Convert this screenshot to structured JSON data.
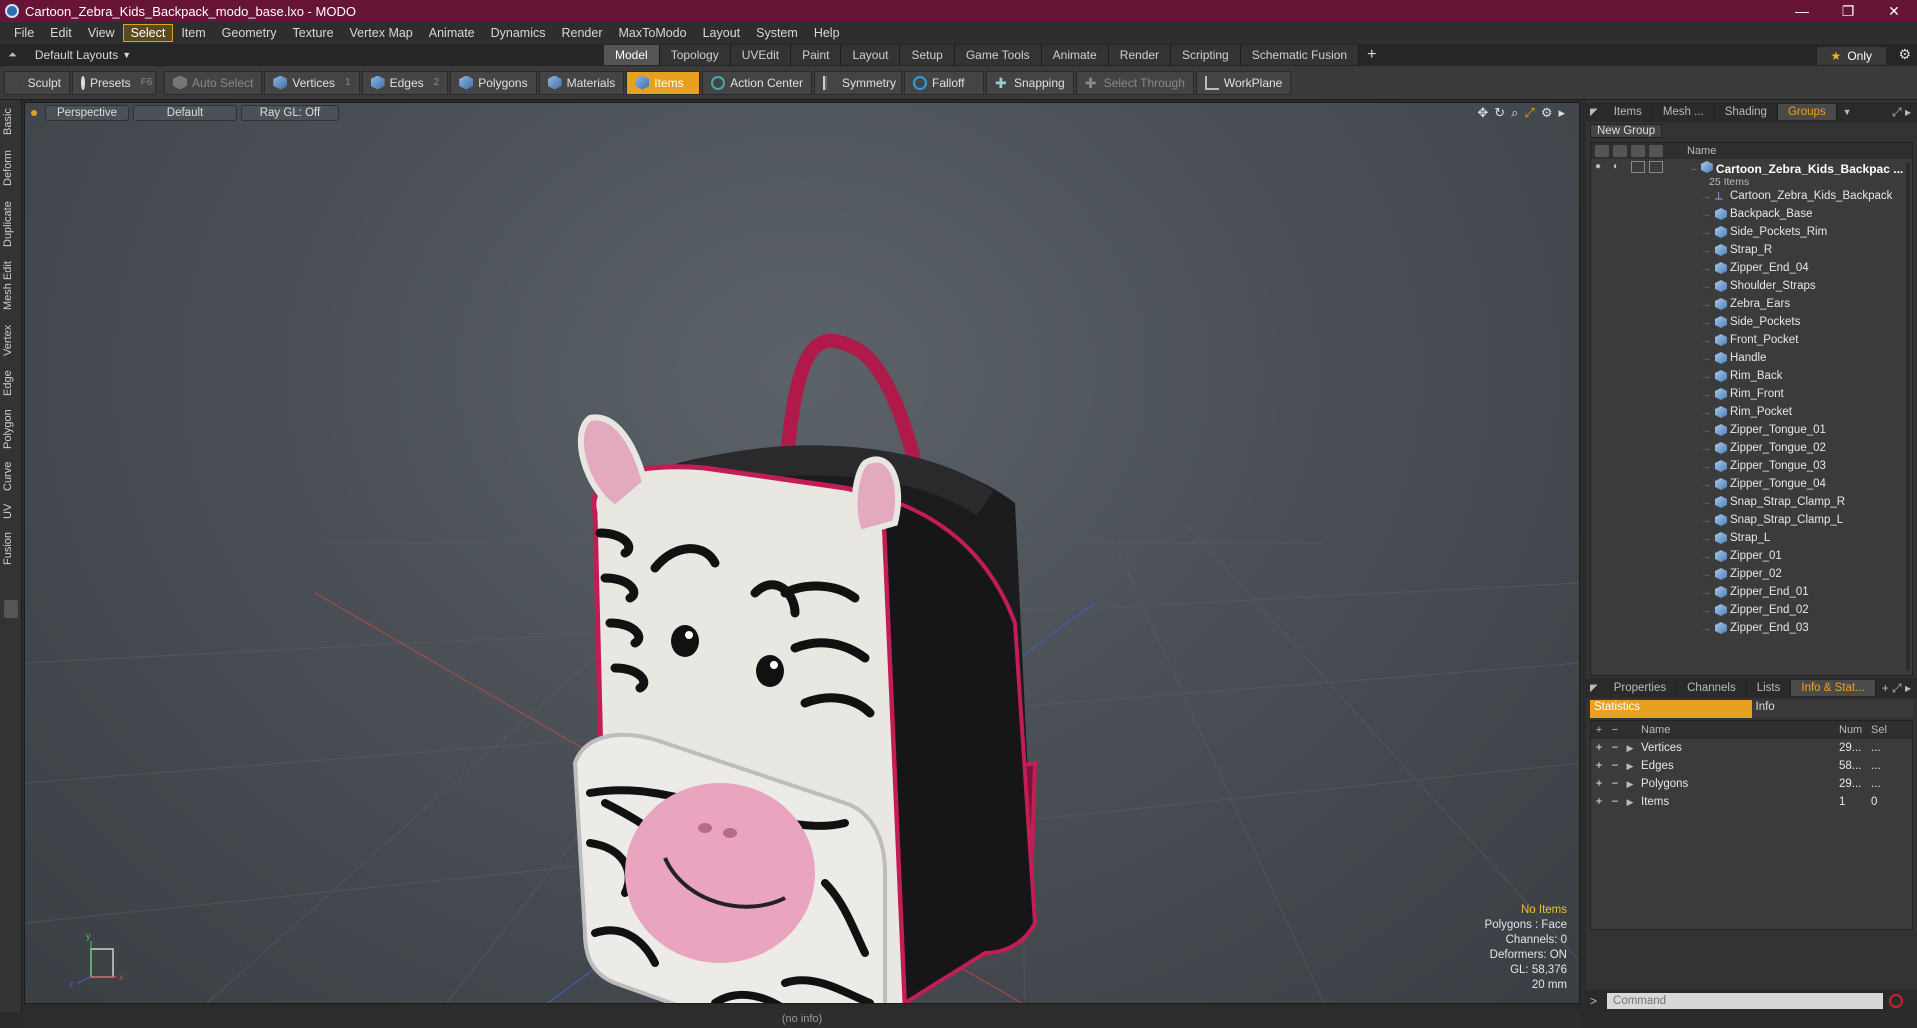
{
  "window": {
    "title": "Cartoon_Zebra_Kids_Backpack_modo_base.lxo - MODO",
    "controls": [
      "—",
      "❐",
      "✕"
    ]
  },
  "menu": [
    "File",
    "Edit",
    "View",
    "Select",
    "Item",
    "Geometry",
    "Texture",
    "Vertex Map",
    "Animate",
    "Dynamics",
    "Render",
    "MaxToModo",
    "Layout",
    "System",
    "Help"
  ],
  "menu_active": "Select",
  "layout_bar": {
    "layouts_label": "Default Layouts",
    "tabs": [
      "Model",
      "Topology",
      "UVEdit",
      "Paint",
      "Layout",
      "Setup",
      "Game Tools",
      "Animate",
      "Render",
      "Scripting",
      "Schematic Fusion"
    ],
    "active_tab": "Model",
    "only_label": "Only"
  },
  "toolbar": {
    "sculpt": "Sculpt",
    "presets": "Presets",
    "presets_hotkey": "F6",
    "auto_select": "Auto Select",
    "vertices": "Vertices",
    "vertices_hotkey": "1",
    "edges": "Edges",
    "edges_hotkey": "2",
    "polygons": "Polygons",
    "materials": "Materials",
    "items": "Items",
    "action_center": "Action Center",
    "symmetry": "Symmetry",
    "falloff": "Falloff",
    "snapping": "Snapping",
    "select_through": "Select Through",
    "workplane": "WorkPlane"
  },
  "left_tabs": [
    "Basic",
    "Deform",
    "Duplicate",
    "Mesh Edit",
    "Vertex",
    "Edge",
    "Polygon",
    "Curve",
    "UV",
    "Fusion"
  ],
  "viewport": {
    "view": "Perspective",
    "shading": "Default",
    "raygl": "Ray GL: Off",
    "info": {
      "selection": "No Items",
      "polygons": "Polygons : Face",
      "channels": "Channels: 0",
      "deformers": "Deformers: ON",
      "gl": "GL: 58,376",
      "scale": "20 mm"
    }
  },
  "outliner": {
    "tabs": [
      "Items",
      "Mesh ...",
      "Shading",
      "Groups"
    ],
    "active_tab": "Groups",
    "new_group": "New Group",
    "column_name": "Name",
    "group_name": "Cartoon_Zebra_Kids_Backpac ...",
    "group_count": "25 Items",
    "items": [
      "Cartoon_Zebra_Kids_Backpack",
      "Backpack_Base",
      "Side_Pockets_Rim",
      "Strap_R",
      "Zipper_End_04",
      "Shoulder_Straps",
      "Zebra_Ears",
      "Side_Pockets",
      "Front_Pocket",
      "Handle",
      "Rim_Back",
      "Rim_Front",
      "Rim_Pocket",
      "Zipper_Tongue_01",
      "Zipper_Tongue_02",
      "Zipper_Tongue_03",
      "Zipper_Tongue_04",
      "Snap_Strap_Clamp_R",
      "Snap_Strap_Clamp_L",
      "Strap_L",
      "Zipper_01",
      "Zipper_02",
      "Zipper_End_01",
      "Zipper_End_02",
      "Zipper_End_03"
    ]
  },
  "info_panel": {
    "tabs": [
      "Properties",
      "Channels",
      "Lists",
      "Info & Stat..."
    ],
    "active_tab": "Info & Stat...",
    "sub_tabs": [
      "Statistics",
      "Info"
    ],
    "columns": [
      "Name",
      "Num",
      "Sel"
    ],
    "rows": [
      {
        "name": "Vertices",
        "num": "29...",
        "sel": "..."
      },
      {
        "name": "Edges",
        "num": "58...",
        "sel": "..."
      },
      {
        "name": "Polygons",
        "num": "29...",
        "sel": "..."
      },
      {
        "name": "Items",
        "num": "1",
        "sel": "0"
      }
    ]
  },
  "command": {
    "placeholder": "Command"
  },
  "status": "(no info)",
  "colors": {
    "title_bar": "#681437",
    "accent": "#e8a020",
    "viewport_bg": "#4a5056"
  }
}
